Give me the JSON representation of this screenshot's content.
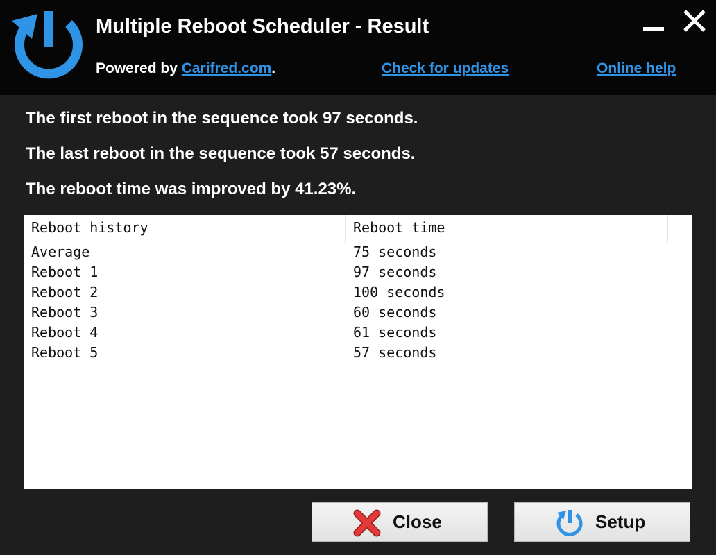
{
  "colors": {
    "titlebar_bg": "#060606",
    "body_bg": "#1e1e1e",
    "accent_blue": "#2f93e6",
    "link_blue": "#2f93e6",
    "close_red": "#e23a3a"
  },
  "header": {
    "title": "Multiple Reboot Scheduler - Result",
    "powered_prefix": "Powered by ",
    "powered_link": "Carifred.com",
    "powered_suffix": ".",
    "check_updates": "Check for updates",
    "online_help": "Online help",
    "logo_icon": "power-icon",
    "minimize_icon": "minimize-icon",
    "close_icon": "close-icon"
  },
  "summary": {
    "first": "The first reboot in the sequence took 97 seconds.",
    "last": "The last reboot in the sequence took 57 seconds.",
    "improvement": "The reboot time was improved by 41.23%."
  },
  "history": {
    "columns": [
      "Reboot history",
      "Reboot time"
    ],
    "rows": [
      {
        "name": "Average",
        "time": "75 seconds"
      },
      {
        "name": "Reboot 1",
        "time": "97 seconds"
      },
      {
        "name": "Reboot 2",
        "time": "100 seconds"
      },
      {
        "name": "Reboot 3",
        "time": "60 seconds"
      },
      {
        "name": "Reboot 4",
        "time": "61 seconds"
      },
      {
        "name": "Reboot 5",
        "time": "57 seconds"
      }
    ]
  },
  "buttons": {
    "close_label": "Close",
    "close_icon": "red-x-icon",
    "setup_label": "Setup",
    "setup_icon": "power-icon"
  }
}
